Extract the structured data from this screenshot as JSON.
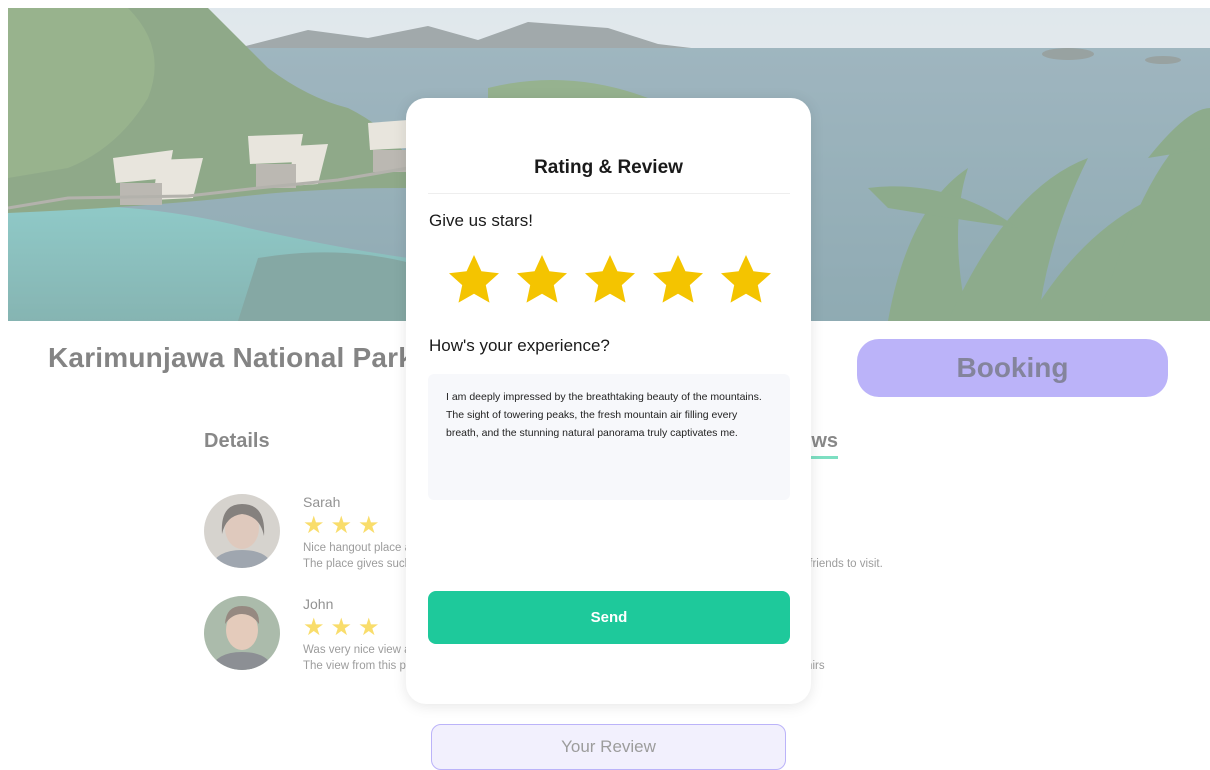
{
  "page": {
    "title": "Karimunjawa National Park",
    "booking_label": "Booking",
    "tabs": [
      {
        "label": "Details"
      },
      {
        "label": "Reviews"
      }
    ],
    "reviews": [
      {
        "name": "Sarah",
        "rating": 3,
        "lines": [
          "Nice hangout place and very beautiful view.",
          "The place gives such a calm and peaceful atmosphere, perfect for a holiday trip with the family and friends to visit."
        ]
      },
      {
        "name": "John",
        "rating": 3,
        "lines": [
          "Was very nice view and the service was good.",
          "The view from this place is amazing, there are also a lot of restaurants nearby and stores for souvenirs"
        ]
      }
    ],
    "your_review_label": "Your Review"
  },
  "modal": {
    "title": "Rating & Review",
    "stars_label": "Give us stars!",
    "rating": 5,
    "max_rating": 5,
    "experience_label": "How's your experience?",
    "review_text": "I am deeply impressed by the breathtaking beauty of the mountains. The sight of towering peaks, the fresh mountain air filling every breath, and the stunning natural panorama truly captivates me.",
    "send_label": "Send"
  },
  "colors": {
    "star": "#f4c400",
    "accent_green": "#1ec99b",
    "accent_purple": "#8a7cf4"
  },
  "icons": {
    "star": "star-icon"
  }
}
